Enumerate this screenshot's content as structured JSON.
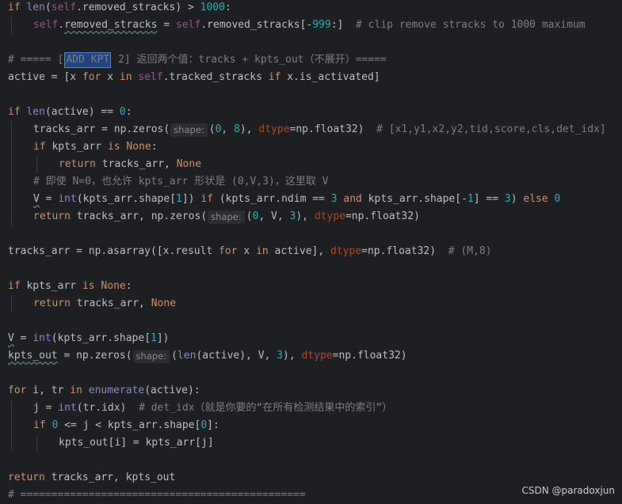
{
  "code": {
    "l1": {
      "kw": "if ",
      "fn": "len",
      "open": "(",
      "self": "self",
      "attr": ".removed_stracks) > ",
      "num": "1000",
      "end": ":"
    },
    "l2": {
      "self": "self",
      "dot": ".",
      "name": "removed_stracks",
      "eq": " = ",
      "self2": "self",
      "rest": ".removed_stracks[-",
      "num": "999",
      "rest2": ":]  ",
      "comment": "# clip remove stracks to 1000 maximum"
    },
    "l3": {
      "pre": "# ===== [",
      "sel": "ADD KPT",
      "post": " 2] 返回两个值：tracks + kpts_out（不展开）====="
    },
    "l4": {
      "a": "active = [x ",
      "kw1": "for",
      "b": " x ",
      "kw2": "in",
      "c": " ",
      "self": "self",
      "d": ".tracked_stracks ",
      "kw3": "if",
      "e": " x.is_activated]"
    },
    "l5": {
      "kw": "if ",
      "fn": "len",
      "a": "(active) == ",
      "num": "0",
      "b": ":"
    },
    "l6": {
      "a": "tracks_arr = np.zeros(",
      "hint": "shape:",
      "b": "(",
      "n1": "0",
      "c": ", ",
      "n2": "8",
      "d": "), ",
      "param": "dtype",
      "e": "=np.float32)  ",
      "comment": "# [x1,y1,x2,y2,tid,score,cls,det_idx]"
    },
    "l7": {
      "kw1": "if",
      "a": " kpts_arr ",
      "kw2": "is",
      "b": " ",
      "kw3": "None",
      "c": ":"
    },
    "l8": {
      "kw1": "return",
      "a": " tracks_arr, ",
      "kw2": "None"
    },
    "l9": {
      "comment": "# 即使 N=0，也允许 kpts_arr 形状是 (0,V,3)，这里取 V"
    },
    "l10": {
      "v": "V",
      "a": " = ",
      "fn": "int",
      "b": "(kpts_arr.shape[",
      "n1": "1",
      "c": "]) ",
      "kw1": "if",
      "d": " (kpts_arr.ndim == ",
      "n2": "3",
      "e": " ",
      "kw2": "and",
      "f": " kpts_arr.shape[-",
      "n3": "1",
      "g": "] == ",
      "n4": "3",
      "h": ") ",
      "kw3": "else",
      "i": " ",
      "n5": "0"
    },
    "l11": {
      "kw": "return",
      "a": " tracks_arr, np.zeros(",
      "hint": "shape:",
      "b": "(",
      "n1": "0",
      "c": ", V, ",
      "n2": "3",
      "d": "), ",
      "param": "dtype",
      "e": "=np.float32)"
    },
    "l12": {
      "a": "tracks_arr = np.asarray([x.result ",
      "kw1": "for",
      "b": " x ",
      "kw2": "in",
      "c": " active], ",
      "param": "dtype",
      "d": "=np.float32)  ",
      "comment": "# (M,8)"
    },
    "l13": {
      "kw1": "if",
      "a": " kpts_arr ",
      "kw2": "is",
      "b": " ",
      "kw3": "None",
      "c": ":"
    },
    "l14": {
      "kw1": "return",
      "a": " tracks_arr, ",
      "kw2": "None"
    },
    "l15": {
      "v": "V",
      "a": " = ",
      "fn": "int",
      "b": "(kpts_arr.shape[",
      "n1": "1",
      "c": "])"
    },
    "l16": {
      "v": "kpts_out",
      "a": " = np.zeros(",
      "hint": "shape:",
      "b": "(",
      "fn": "len",
      "c": "(active), V, ",
      "n1": "3",
      "d": "), ",
      "param": "dtype",
      "e": "=np.float32)"
    },
    "l17": {
      "kw1": "for",
      "a": " i, tr ",
      "kw2": "in",
      "b": " ",
      "fn": "enumerate",
      "c": "(active):"
    },
    "l18": {
      "a": "j = ",
      "fn": "int",
      "b": "(tr.idx)  ",
      "comment": "# det_idx（就是你要的“在所有检测结果中的索引”）"
    },
    "l19": {
      "kw": "if",
      "a": " ",
      "n1": "0",
      "b": " <= j < kpts_arr.shape[",
      "n2": "0",
      "c": "]:"
    },
    "l20": {
      "a": "kpts_out[i] = kpts_arr[j]"
    },
    "l21": {
      "kw": "return",
      "a": " tracks_arr, kpts_out"
    },
    "l22": {
      "comment": "# =============================================="
    }
  },
  "watermark": "CSDN @paradoxjun",
  "colors": {
    "background": "#1e1f22",
    "keyword": "#cf8e6d",
    "number": "#2aacb8",
    "comment": "#7a7e85",
    "self": "#94558d",
    "param": "#aa4926",
    "builtin": "#8888c6"
  }
}
